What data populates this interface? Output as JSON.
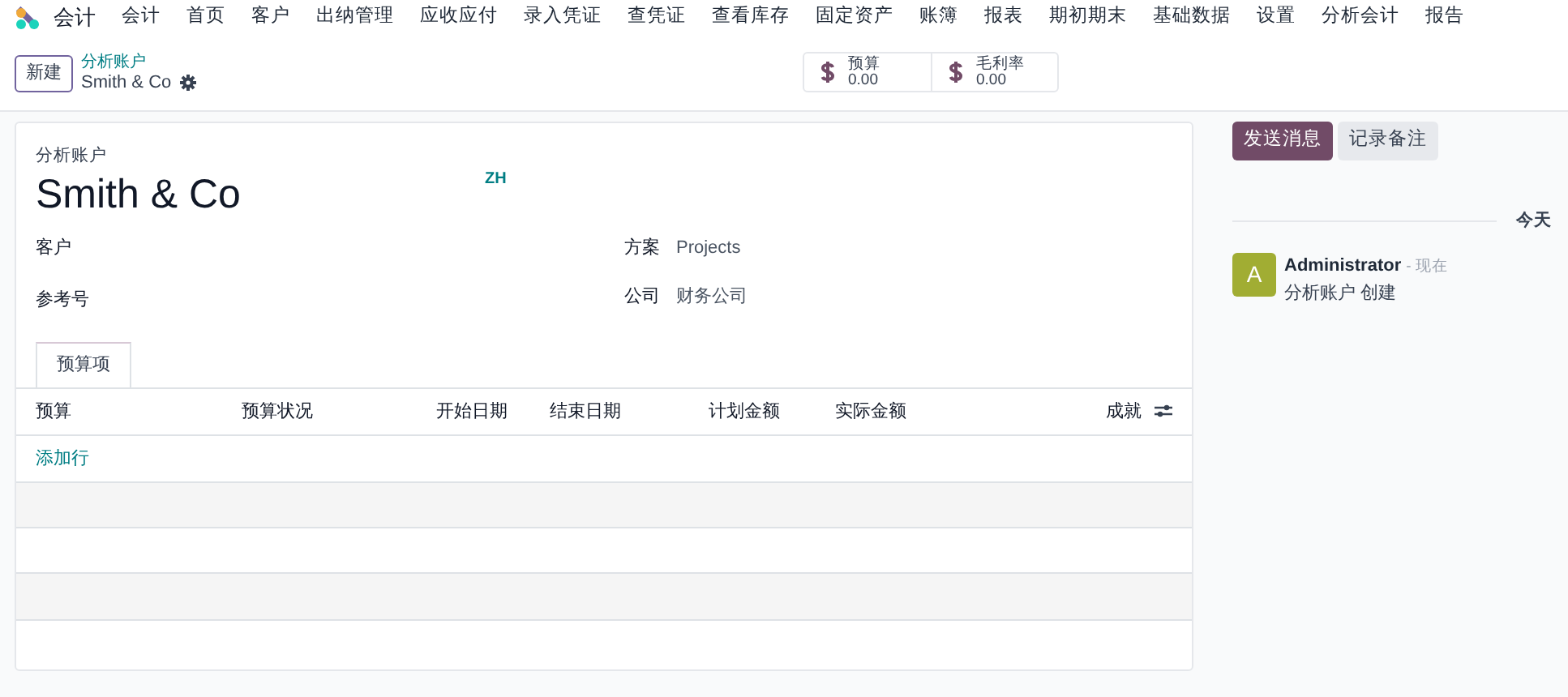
{
  "nav": {
    "app_name": "会计",
    "menu": [
      "会计",
      "首页",
      "客户",
      "出纳管理",
      "应收应付",
      "录入凭证",
      "查凭证",
      "查看库存",
      "固定资产",
      "账簿",
      "报表",
      "期初期末",
      "基础数据",
      "设置",
      "分析会计",
      "报告"
    ]
  },
  "control_bar": {
    "new_button": "新建",
    "breadcrumb_parent": "分析账户",
    "record_name": "Smith & Co",
    "stats": [
      {
        "label": "预算",
        "value": "0.00"
      },
      {
        "label": "毛利率",
        "value": "0.00"
      }
    ]
  },
  "form": {
    "caption": "分析账户",
    "name": "Smith & Co",
    "language": "ZH",
    "left_fields": [
      {
        "label": "客户"
      },
      {
        "label": "参考号"
      }
    ],
    "right_fields": [
      {
        "label": "方案",
        "value": "Projects"
      },
      {
        "label": "公司",
        "value": "财务公司"
      }
    ],
    "tabs": [
      {
        "label": "预算项",
        "selected": true
      }
    ],
    "table": {
      "columns": [
        "预算",
        "预算状况",
        "开始日期",
        "结束日期",
        "计划金额",
        "实际金额",
        "成就"
      ],
      "add_line": "添加行"
    }
  },
  "chatter": {
    "buttons": [
      {
        "label": "发送消息",
        "kind": "primary"
      },
      {
        "label": "记录备注",
        "kind": "secondary"
      }
    ],
    "date_label": "今天",
    "messages": [
      {
        "avatar": "A",
        "color": "#a1ad33",
        "author": "Administrator",
        "time": "- 现在",
        "body": "分析账户 创建"
      }
    ]
  }
}
